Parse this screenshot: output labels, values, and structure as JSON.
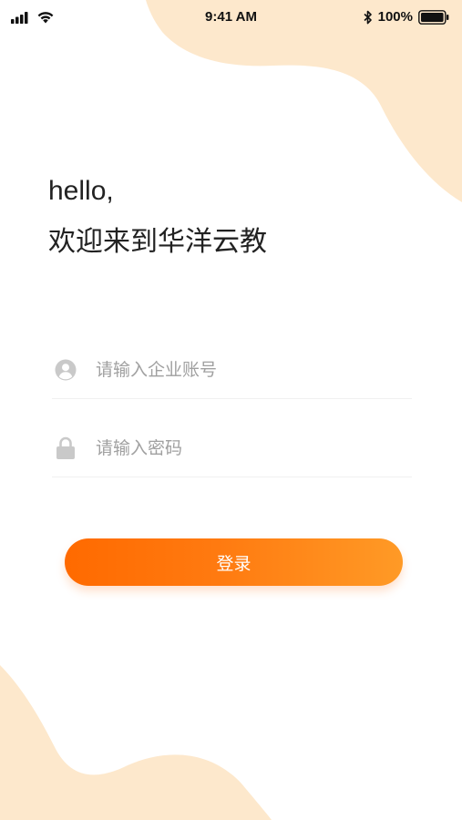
{
  "status_bar": {
    "time": "9:41 AM",
    "battery": "100%",
    "icons": [
      "signal-icon",
      "wifi-icon",
      "bluetooth-icon",
      "battery-icon"
    ]
  },
  "greeting": {
    "hello": "hello,",
    "welcome": "欢迎来到华洋云教"
  },
  "form": {
    "account_placeholder": "请输入企业账号",
    "account_icon": "user-icon",
    "password_placeholder": "请输入密码",
    "password_icon": "lock-icon",
    "login_label": "登录"
  },
  "colors": {
    "accent_start": "#ff6a00",
    "accent_end": "#ff9a26",
    "blob": "#fde8cc"
  }
}
